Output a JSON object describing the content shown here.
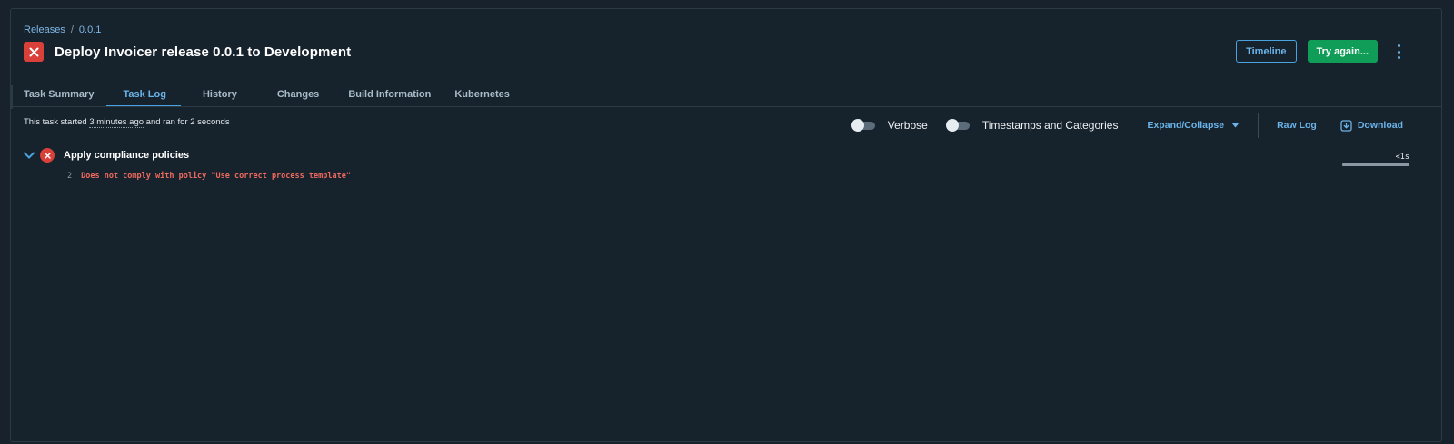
{
  "breadcrumb": {
    "root": "Releases",
    "separator": "/",
    "current": "0.0.1"
  },
  "header": {
    "title": "Deploy Invoicer release 0.0.1 to Development",
    "status": "failed"
  },
  "actions": {
    "timeline_label": "Timeline",
    "try_again_label": "Try again..."
  },
  "tabs": [
    {
      "label": "Task Summary",
      "active": false
    },
    {
      "label": "Task Log",
      "active": true
    },
    {
      "label": "History",
      "active": false
    },
    {
      "label": "Changes",
      "active": false
    },
    {
      "label": "Build Information",
      "active": false
    },
    {
      "label": "Kubernetes",
      "active": false
    }
  ],
  "task_info": {
    "prefix": "This task started ",
    "started": "3 minutes ago",
    "suffix": " and ran for 2 seconds"
  },
  "toolbar": {
    "verbose_label": "Verbose",
    "verbose_on": false,
    "timestamps_label": "Timestamps and Categories",
    "timestamps_on": false,
    "expand_label": "Expand/Collapse",
    "raw_log_label": "Raw Log",
    "download_label": "Download"
  },
  "log": {
    "step_name": "Apply compliance policies",
    "duration": "<1s",
    "lines": [
      {
        "number": "2",
        "text": "Does not comply with policy \"Use correct process template\""
      }
    ]
  },
  "colors": {
    "accent": "#4aa3df",
    "success": "#0f9d58",
    "error": "#d9403a",
    "background": "#17222c"
  },
  "icons": [
    "close-icon",
    "kebab-menu-icon",
    "chevron-down-icon",
    "error-icon",
    "download-icon"
  ]
}
